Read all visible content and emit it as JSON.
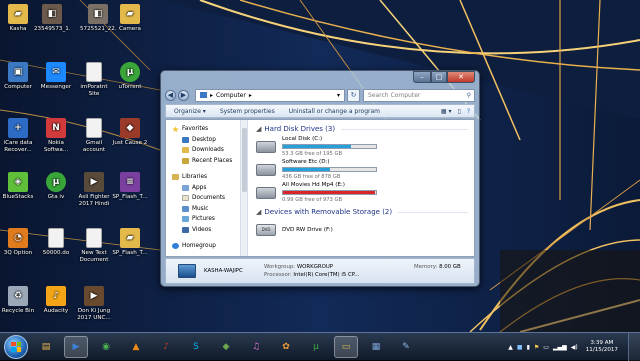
{
  "desktop": {
    "icons": [
      {
        "label": "Kasha",
        "icon": "folder-icon",
        "color": "#e2b94a"
      },
      {
        "label": "23549573_1...",
        "icon": "photo-icon",
        "color": "#6b5a4c"
      },
      {
        "label": "5725521_22...",
        "icon": "photo-icon",
        "color": "#7a7066"
      },
      {
        "label": "Camera",
        "icon": "folder-icon",
        "color": "#e2b94a"
      },
      {
        "label": "Computer",
        "icon": "computer-icon",
        "color": "#3b79c4"
      },
      {
        "label": "Messenger",
        "icon": "messenger-icon",
        "color": "#1e88ff"
      },
      {
        "label": "imPoratnt Site",
        "icon": "document-icon",
        "color": "#f2f2f2"
      },
      {
        "label": "uTorrent",
        "icon": "utorrent-icon",
        "color": "#3aa63a"
      },
      {
        "label": "iCare data Recover...",
        "icon": "icare-icon",
        "color": "#2c6cc6"
      },
      {
        "label": "Nokia Softwa...",
        "icon": "nokia-icon",
        "color": "#d23b3b"
      },
      {
        "label": "Gmail account",
        "icon": "document-icon",
        "color": "#f2f2f2"
      },
      {
        "label": "Just Cause 2",
        "icon": "game-icon",
        "color": "#9a3b2a"
      },
      {
        "label": "BlueStacks",
        "icon": "bluestacks-icon",
        "color": "#5fbf3a"
      },
      {
        "label": "Gta iv",
        "icon": "utorrent-icon",
        "color": "#3aa63a"
      },
      {
        "label": "Asli Fighter 2017 Hindi ...",
        "icon": "video-icon",
        "color": "#5a4a3a"
      },
      {
        "label": "SP_Flash_T...",
        "icon": "winrar-icon",
        "color": "#7b3fa0"
      },
      {
        "label": "3Q Option",
        "icon": "chart-icon",
        "color": "#e07b1e"
      },
      {
        "label": "50000.do",
        "icon": "document-icon",
        "color": "#f2f2f2"
      },
      {
        "label": "New Text Document",
        "icon": "document-icon",
        "color": "#f2f2f2"
      },
      {
        "label": "SP_Flash_T...",
        "icon": "folder-icon",
        "color": "#e2b94a"
      },
      {
        "label": "Recycle Bin",
        "icon": "recycle-bin-icon",
        "color": "#9aa8b8"
      },
      {
        "label": "Audacity",
        "icon": "audacity-icon",
        "color": "#f2a516"
      },
      {
        "label": "Don Ki Jung 2017 UNC...",
        "icon": "video-icon",
        "color": "#6a4a2e"
      }
    ]
  },
  "window": {
    "address_root": "Computer",
    "search_placeholder": "Search Computer",
    "toolbar": {
      "organize": "Organize ▾",
      "system_properties": "System properties",
      "uninstall": "Uninstall or change a program"
    },
    "nav": {
      "favorites": "Favorites",
      "favorites_items": [
        "Desktop",
        "Downloads",
        "Recent Places"
      ],
      "libraries": "Libraries",
      "libraries_items": [
        "Apps",
        "Documents",
        "Music",
        "Pictures",
        "Videos"
      ],
      "homegroup": "Homegroup"
    },
    "hard_disk_header": "Hard Disk Drives (3)",
    "drives": [
      {
        "name": "Local Disk (C:)",
        "free": "53.3 GB free of 195 GB",
        "used_fraction": 0.73,
        "bar_color": "#26a0da"
      },
      {
        "name": "Software Etc (D:)",
        "free": "436 GB free of 878 GB",
        "used_fraction": 0.5,
        "bar_color": "#26a0da"
      },
      {
        "name": "All Movies Hd Mp4 (E:)",
        "free": "0.99 GB free of 973 GB",
        "used_fraction": 0.99,
        "bar_color": "#da2626"
      }
    ],
    "removable_header": "Devices with Removable Storage (2)",
    "removable": [
      {
        "name": "DVD RW Drive (F:)"
      }
    ],
    "details": {
      "computer_name": "KASHA-WAJIPC",
      "workgroup_label": "Workgroup:",
      "workgroup": "WORKGROUP",
      "memory_label": "Memory:",
      "memory": "8.00 GB",
      "processor_label": "Processor:",
      "processor": "Intel(R) Core(TM) i5 CP..."
    }
  },
  "taskbar": {
    "apps": [
      {
        "name": "start-orb",
        "glyph": ""
      },
      {
        "name": "explorer-icon",
        "glyph": "▤",
        "color": "#e8b84a"
      },
      {
        "name": "media-player-icon",
        "glyph": "▶",
        "color": "#3a82d8"
      },
      {
        "name": "chrome-icon",
        "glyph": "◉",
        "color": "#4caf50"
      },
      {
        "name": "vlc-icon",
        "glyph": "▲",
        "color": "#f08a16"
      },
      {
        "name": "winamp-icon",
        "glyph": "♪",
        "color": "#c0392b"
      },
      {
        "name": "skype-icon",
        "glyph": "S",
        "color": "#00aff0"
      },
      {
        "name": "game-icon",
        "glyph": "◆",
        "color": "#6aa84f"
      },
      {
        "name": "itunes-icon",
        "glyph": "♫",
        "color": "#d070c8"
      },
      {
        "name": "fl-studio-icon",
        "glyph": "✿",
        "color": "#f0a030"
      },
      {
        "name": "utorrent-icon",
        "glyph": "µ",
        "color": "#3aa63a"
      },
      {
        "name": "folder-icon",
        "glyph": "▭",
        "color": "#e2b94a"
      },
      {
        "name": "task-icon",
        "glyph": "▦",
        "color": "#7aa3d6"
      },
      {
        "name": "notepad-icon",
        "glyph": "✎",
        "color": "#8fb5e0"
      }
    ],
    "clock_time": "3:39 AM",
    "clock_date": "11/15/2017"
  }
}
